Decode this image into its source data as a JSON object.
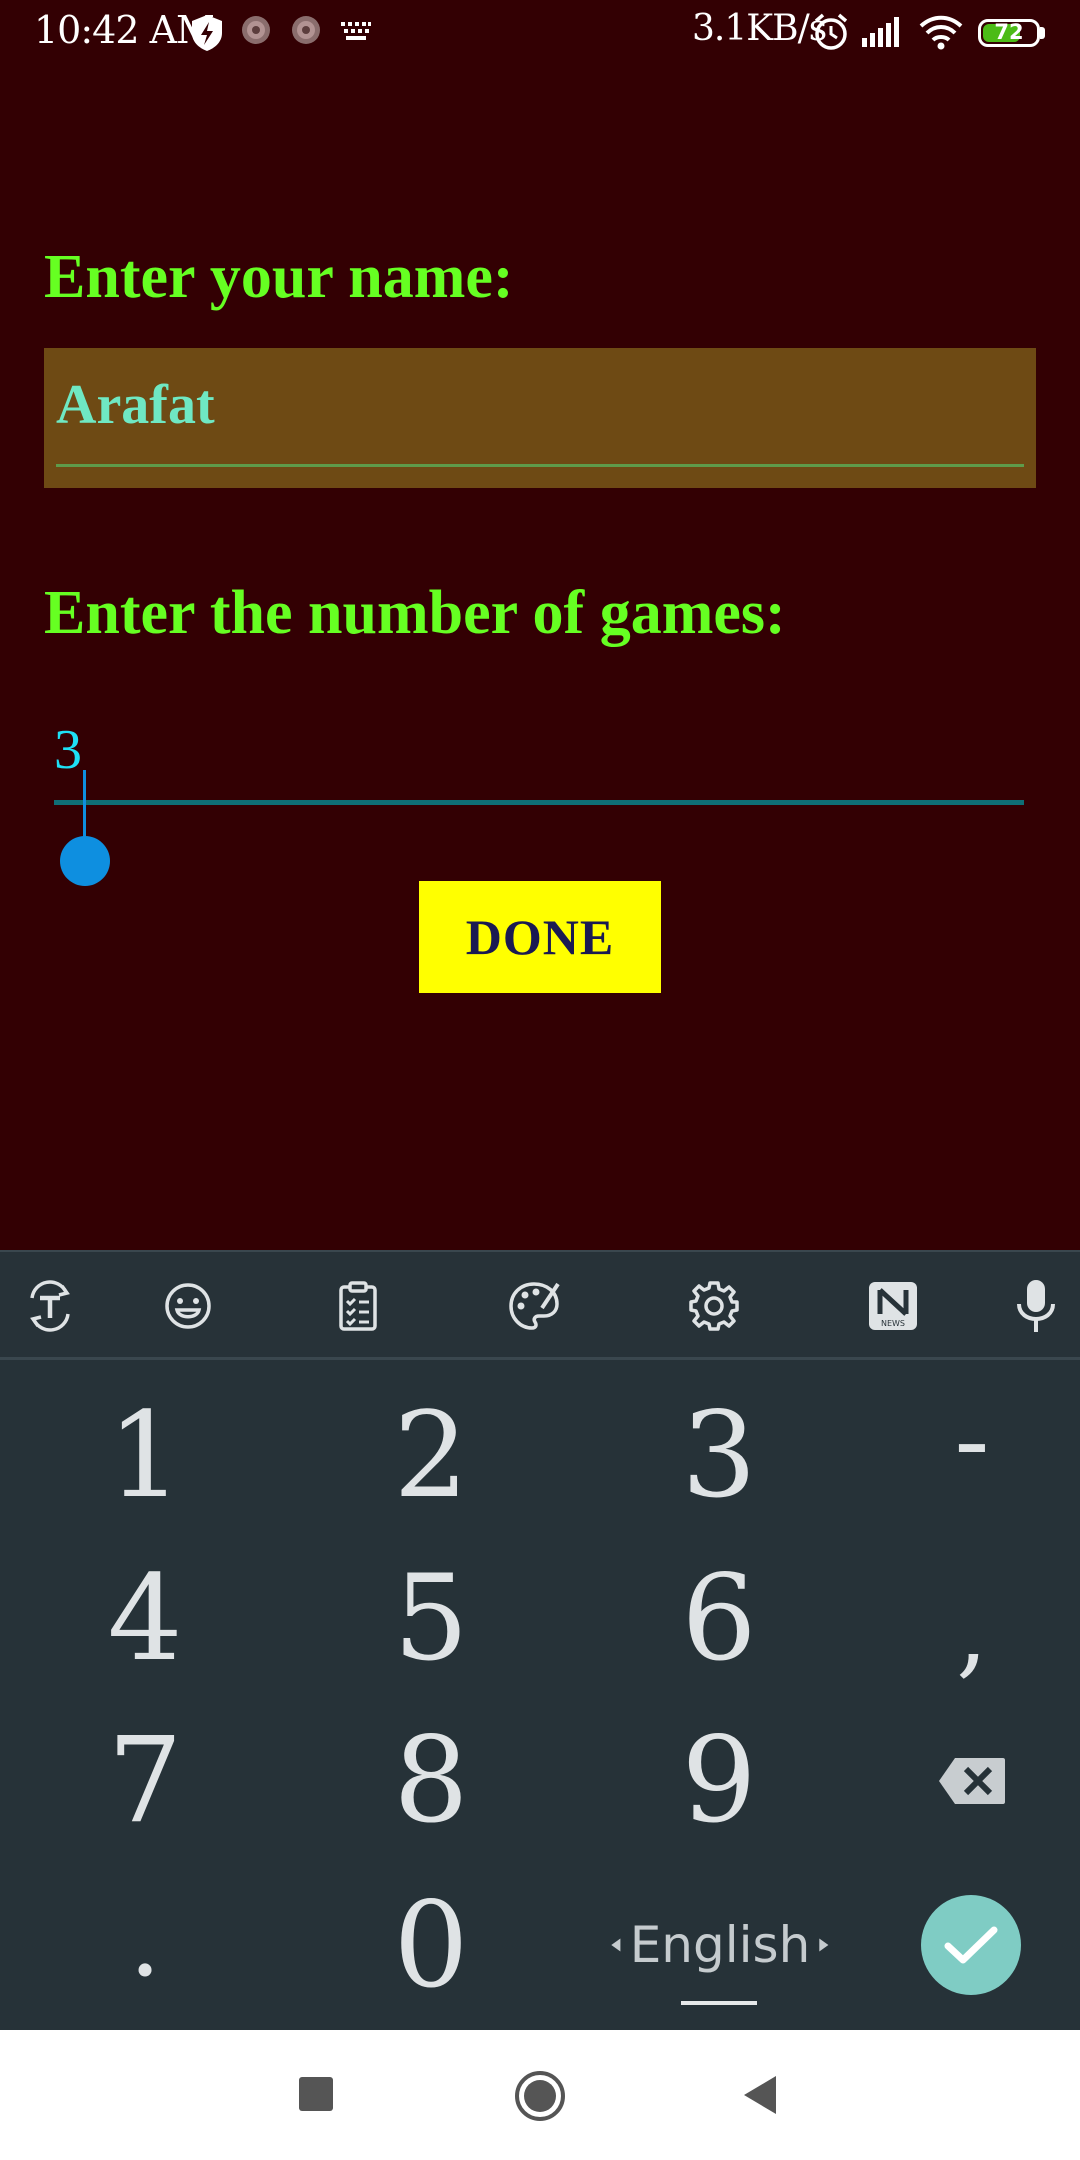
{
  "status_bar": {
    "time": "10:42 AM",
    "net_speed": "3.1KB/s",
    "battery_level": "72",
    "battery_fraction": 0.72,
    "icons": [
      "shield-bolt-icon",
      "notification-dot-icon",
      "notification-dot-icon",
      "keyboard-icon",
      "alarm-icon",
      "signal-icon",
      "wifi-icon",
      "battery-icon"
    ]
  },
  "form": {
    "name_label": "Enter your name:",
    "name_value": "Arafat",
    "games_label": "Enter the number of games:",
    "games_value": "3",
    "done_label": "DONE"
  },
  "keyboard": {
    "toolbar_icons": [
      "translate-icon",
      "emoji-icon",
      "clipboard-icon",
      "theme-palette-icon",
      "settings-icon",
      "news-icon",
      "microphone-icon"
    ],
    "keys": {
      "k1": "1",
      "k2": "2",
      "k3": "3",
      "dash": "-",
      "k4": "4",
      "k5": "5",
      "k6": "6",
      "comma": ",",
      "k7": "7",
      "k8": "8",
      "k9": "9",
      "dot": ".",
      "k0": "0"
    },
    "language": "English",
    "news_badge": "NEWS"
  },
  "colors": {
    "background": "#330003",
    "label_green": "#66ff22",
    "name_box": "#6e4a14",
    "name_text": "#6fe8c3",
    "games_text": "#1ee0f5",
    "done_bg": "#ffff00",
    "keyboard_bg": "#263238",
    "enter_bg": "#7fccc4"
  },
  "navigation": {
    "icons": [
      "recent-apps-icon",
      "home-icon",
      "back-icon"
    ]
  }
}
